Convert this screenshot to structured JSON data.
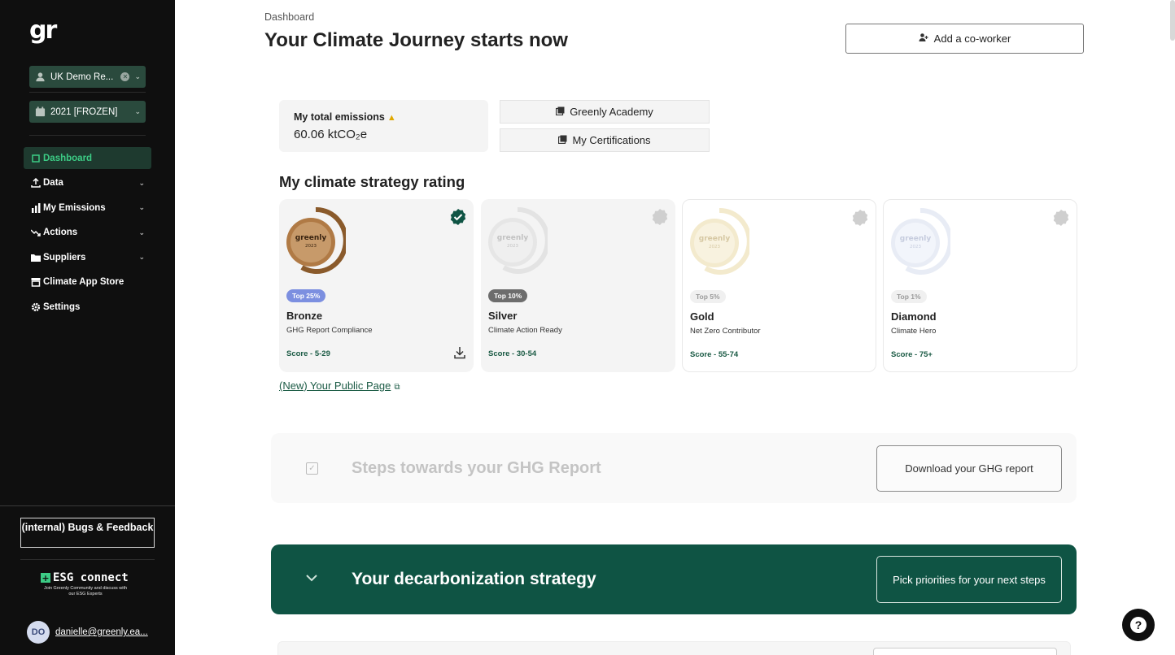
{
  "sidebar": {
    "logo": "gr",
    "org_select": {
      "value": "UK Demo Re..."
    },
    "year_select": {
      "value": "2021 [FROZEN]"
    },
    "nav": [
      {
        "label": "Dashboard",
        "icon": "square-icon",
        "active": true
      },
      {
        "label": "Data",
        "icon": "upload-icon",
        "has_children": true
      },
      {
        "label": "My Emissions",
        "icon": "bar-chart-icon",
        "has_children": true
      },
      {
        "label": "Actions",
        "icon": "trend-down-icon",
        "has_children": true
      },
      {
        "label": "Suppliers",
        "icon": "folder-icon",
        "has_children": true
      },
      {
        "label": "Climate App Store",
        "icon": "store-icon"
      },
      {
        "label": "Settings",
        "icon": "gear-icon"
      }
    ],
    "bugs_button": "(internal) Bugs & Feedback",
    "esg": {
      "title": "ESG connect",
      "subtitle": "Join Greenly Community and discuss with our ESG Experts"
    },
    "user": {
      "initials": "DO",
      "email": "danielle@greenly.ea..."
    }
  },
  "header": {
    "breadcrumb": "Dashboard",
    "title": "Your Climate Journey starts now",
    "add_coworker": "Add a co-worker"
  },
  "emissions": {
    "label": "My total emissions",
    "value": "60.06 ktCO₂e"
  },
  "links": {
    "academy": "Greenly Academy",
    "certifications": "My Certifications"
  },
  "rating": {
    "title": "My climate strategy rating",
    "cards": [
      {
        "name": "Bronze",
        "subtitle": "GHG Report Compliance",
        "score": "Score - 5-29",
        "pill": "Top 25%",
        "achieved": true,
        "medal_color": "#b07a45",
        "pill_bg": "#7c8fe0",
        "pill_fg": "#ffffff"
      },
      {
        "name": "Silver",
        "subtitle": "Climate Action Ready",
        "score": "Score - 30-54",
        "pill": "Top 10%",
        "achieved": false,
        "medal_color": "#cfcfcf",
        "pill_bg": "#6d6d6d",
        "pill_fg": "#ffffff"
      },
      {
        "name": "Gold",
        "subtitle": "Net Zero Contributor",
        "score": "Score - 55-74",
        "pill": "Top 5%",
        "achieved": false,
        "medal_color": "#e6cf8d",
        "pill_bg": "#f0f0f0",
        "pill_fg": "#9a9a9a"
      },
      {
        "name": "Diamond",
        "subtitle": "Climate Hero",
        "score": "Score - 75+",
        "pill": "Top 1%",
        "achieved": false,
        "medal_color": "#c8d2ec",
        "pill_bg": "#f0f0f0",
        "pill_fg": "#9a9a9a"
      }
    ],
    "medal_text": {
      "brand": "greenly",
      "year": "2023"
    },
    "public_page": "(New) Your Public Page"
  },
  "steps": {
    "title": "Steps towards your GHG Report",
    "button": "Download your GHG report"
  },
  "decarb": {
    "title": "Your decarbonization strategy",
    "button": "Pick priorities for your next steps"
  },
  "colors": {
    "sidebar_bg": "#0f0f0f",
    "accent_green": "#3ccc85",
    "brand_dark_green": "#0f5444"
  }
}
